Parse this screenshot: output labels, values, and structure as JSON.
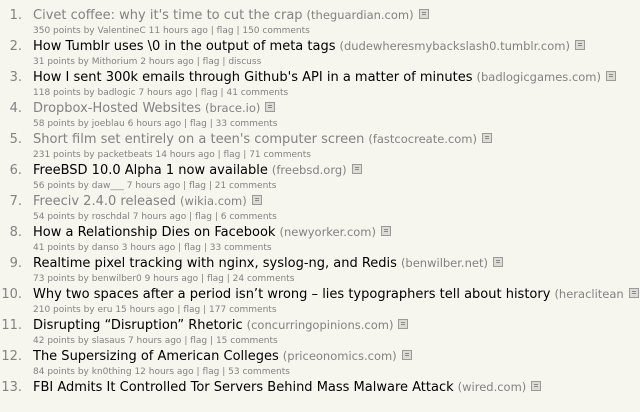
{
  "colors": {
    "title_unvisited": "#000000",
    "title_visited": "#828282",
    "meta": "#828282",
    "background": "#f6f6ef"
  },
  "stories": [
    {
      "rank": "1.",
      "title": "Civet coffee: why it's time to cut the crap",
      "domain": "(theguardian.com)",
      "points": "350 points",
      "by": "by",
      "user": "ValentineC",
      "age": "11 hours ago",
      "flag": "flag",
      "comments": "150 comments",
      "visited": true
    },
    {
      "rank": "2.",
      "title": "How Tumblr uses \\0 in the output of meta tags",
      "domain": "(dudewheresmybackslash0.tumblr.com)",
      "points": "31 points",
      "by": "by",
      "user": "Mithorium",
      "age": "2 hours ago",
      "flag": "flag",
      "comments": "discuss",
      "visited": false
    },
    {
      "rank": "3.",
      "title": "How I sent 300k emails through Github's API in a matter of minutes",
      "domain": "(badlogicgames.com)",
      "points": "118 points",
      "by": "by",
      "user": "badlogic",
      "age": "7 hours ago",
      "flag": "flag",
      "comments": "41 comments",
      "visited": false
    },
    {
      "rank": "4.",
      "title": "Dropbox-Hosted Websites",
      "domain": "(brace.io)",
      "points": "58 points",
      "by": "by",
      "user": "joeblau",
      "age": "6 hours ago",
      "flag": "flag",
      "comments": "33 comments",
      "visited": true
    },
    {
      "rank": "5.",
      "title": "Short film set entirely on a teen's computer screen",
      "domain": "(fastcocreate.com)",
      "points": "231 points",
      "by": "by",
      "user": "packetbeats",
      "age": "14 hours ago",
      "flag": "flag",
      "comments": "71 comments",
      "visited": true
    },
    {
      "rank": "6.",
      "title": "FreeBSD 10.0 Alpha 1 now available",
      "domain": "(freebsd.org)",
      "points": "56 points",
      "by": "by",
      "user": "daw___",
      "age": "7 hours ago",
      "flag": "flag",
      "comments": "21 comments",
      "visited": false
    },
    {
      "rank": "7.",
      "title": "Freeciv 2.4.0 released",
      "domain": "(wikia.com)",
      "points": "54 points",
      "by": "by",
      "user": "roschdal",
      "age": "7 hours ago",
      "flag": "flag",
      "comments": "6 comments",
      "visited": true
    },
    {
      "rank": "8.",
      "title": "How a Relationship Dies on Facebook",
      "domain": "(newyorker.com)",
      "points": "41 points",
      "by": "by",
      "user": "danso",
      "age": "3 hours ago",
      "flag": "flag",
      "comments": "33 comments",
      "visited": false
    },
    {
      "rank": "9.",
      "title": "Realtime pixel tracking with nginx, syslog-ng, and Redis",
      "domain": "(benwilber.net)",
      "points": "73 points",
      "by": "by",
      "user": "benwilber0",
      "age": "9 hours ago",
      "flag": "flag",
      "comments": "24 comments",
      "visited": false
    },
    {
      "rank": "10.",
      "title": "Why two spaces after a period isn’t wrong – lies typographers tell about history",
      "domain": "(heraclitean",
      "points": "210 points",
      "by": "by",
      "user": "eru",
      "age": "15 hours ago",
      "flag": "flag",
      "comments": "177 comments",
      "visited": false
    },
    {
      "rank": "11.",
      "title": "Disrupting “Disruption” Rhetoric",
      "domain": "(concurringopinions.com)",
      "points": "42 points",
      "by": "by",
      "user": "slasaus",
      "age": "7 hours ago",
      "flag": "flag",
      "comments": "15 comments",
      "visited": false
    },
    {
      "rank": "12.",
      "title": "The Supersizing of American Colleges",
      "domain": "(priceonomics.com)",
      "points": "84 points",
      "by": "by",
      "user": "kn0thing",
      "age": "12 hours ago",
      "flag": "flag",
      "comments": "53 comments",
      "visited": false
    },
    {
      "rank": "13.",
      "title": "FBI Admits It Controlled Tor Servers Behind Mass Malware Attack",
      "domain": "(wired.com)",
      "points": "",
      "by": "",
      "user": "",
      "age": "",
      "flag": "",
      "comments": "",
      "visited": false
    }
  ]
}
